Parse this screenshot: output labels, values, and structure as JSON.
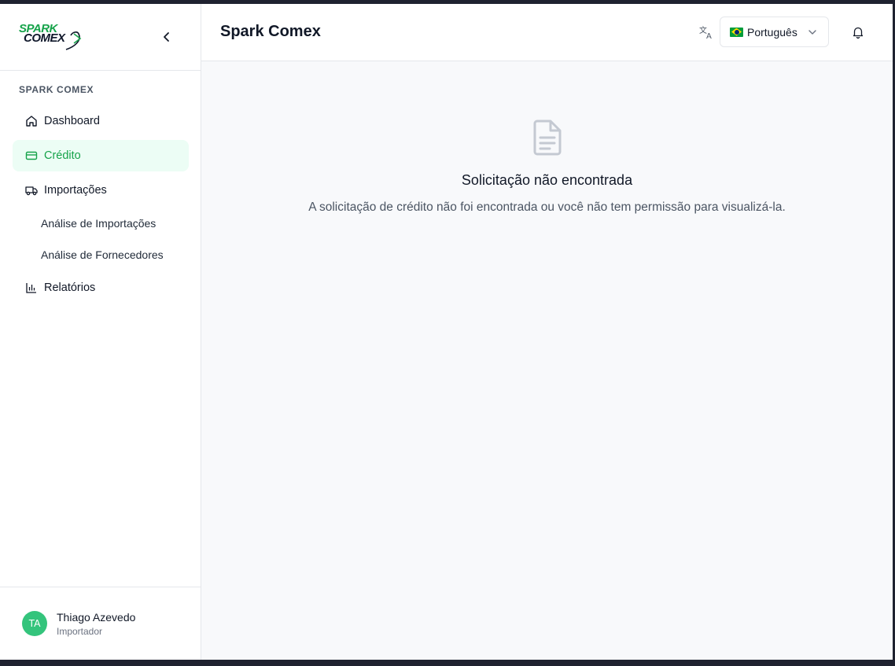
{
  "sidebar": {
    "logo_line1": "SPARK",
    "logo_line2": "COMEX",
    "section_label": "SPARK COMEX",
    "items": [
      {
        "label": "Dashboard",
        "icon": "home-icon"
      },
      {
        "label": "Crédito",
        "icon": "credit-card-icon",
        "active": true
      },
      {
        "label": "Importações",
        "icon": "truck-icon"
      },
      {
        "label": "Relatórios",
        "icon": "bar-chart-icon"
      }
    ],
    "subitems": [
      {
        "label": "Análise de Importações"
      },
      {
        "label": "Análise de Fornecedores"
      }
    ],
    "user": {
      "initials": "TA",
      "name": "Thiago Azevedo",
      "role": "Importador"
    }
  },
  "header": {
    "title": "Spark Comex",
    "language": "Português",
    "language_flag": "brazil-flag-icon"
  },
  "main": {
    "empty_title": "Solicitação não encontrada",
    "empty_description": "A solicitação de crédito não foi encontrada ou você não tem permissão para visualizá-la."
  },
  "colors": {
    "accent": "#16a34a",
    "active_bg": "#ecfdf5",
    "avatar": "#34c47c",
    "main_bg": "#f8f9fb"
  }
}
